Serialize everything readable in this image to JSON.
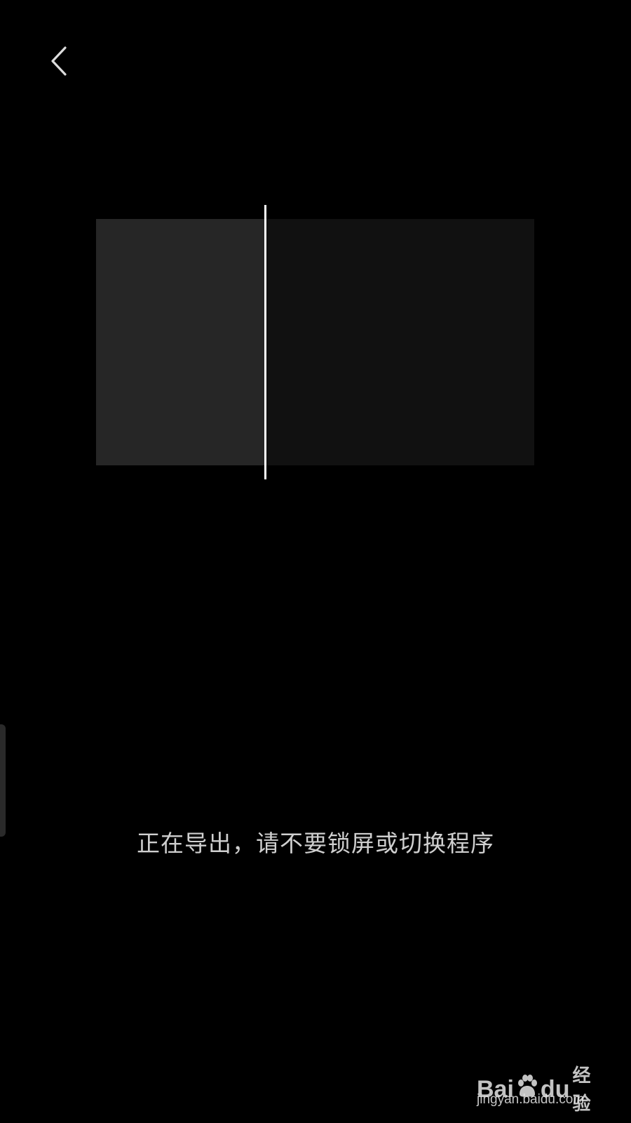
{
  "header": {
    "back_icon": "chevron-left-icon"
  },
  "export": {
    "progress": 0.385,
    "status_text": "正在导出，请不要锁屏或切换程序"
  },
  "watermark": {
    "brand_left": "Bai",
    "brand_right": "du",
    "brand_cn": "经验",
    "url": "jingyan.baidu.com"
  },
  "colors": {
    "background": "#000000",
    "preview_done": "#262626",
    "preview_pending": "#111111",
    "playhead": "#ffffff",
    "status_text": "#cfcfcf"
  }
}
